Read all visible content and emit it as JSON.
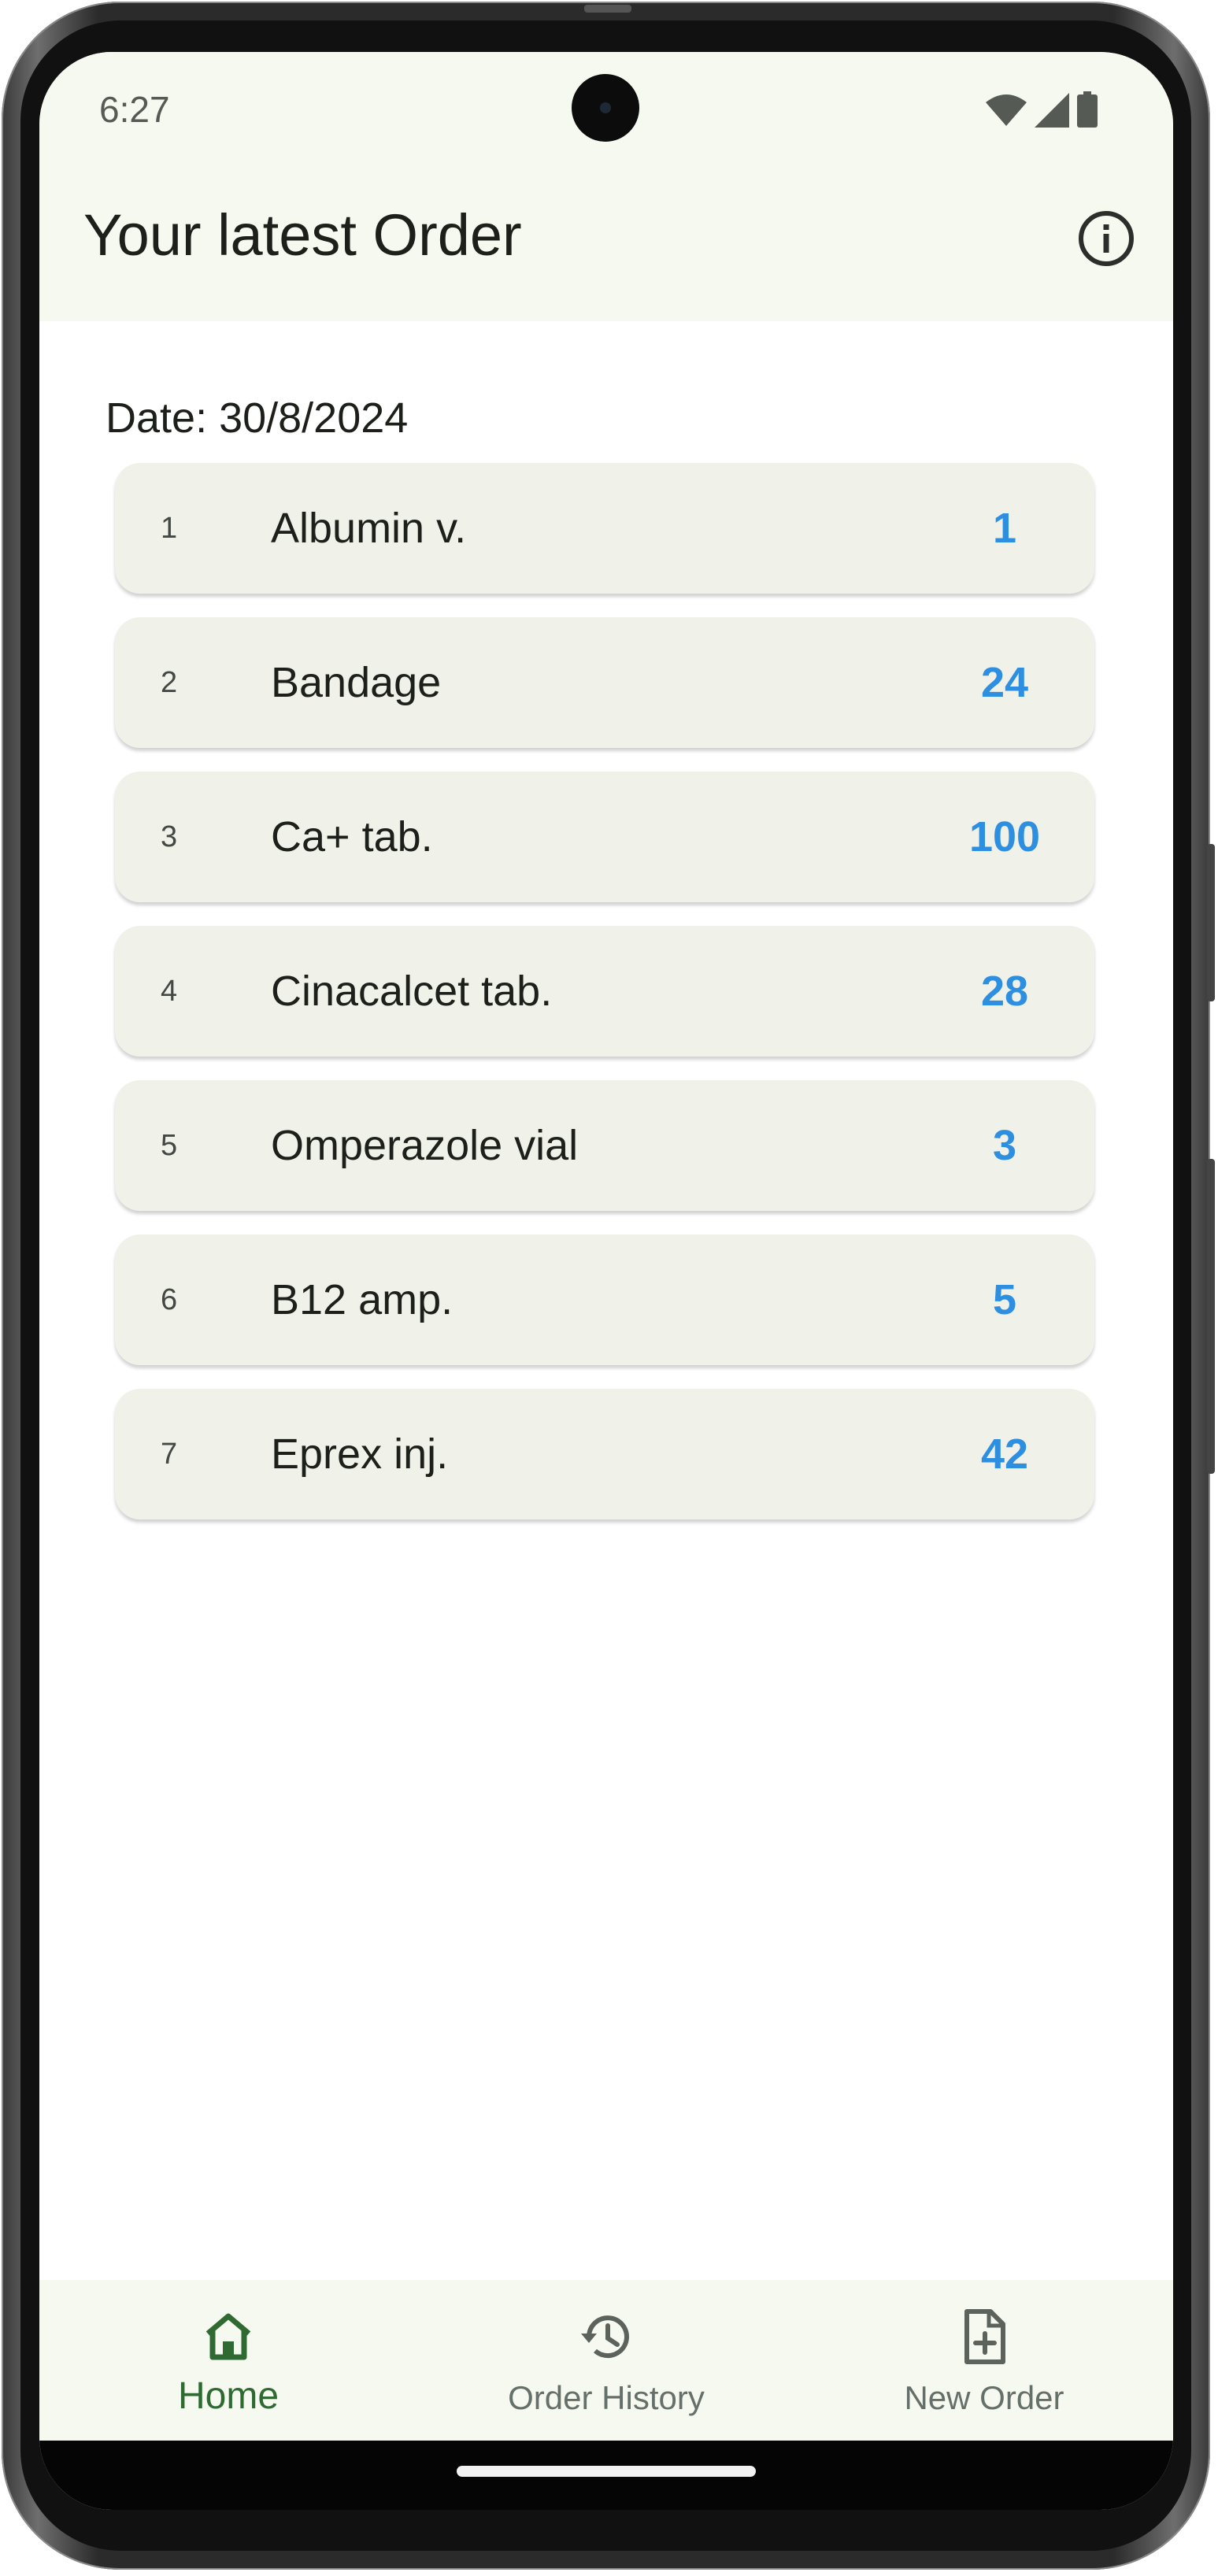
{
  "status_bar": {
    "time": "6:27",
    "icons": [
      "wifi-icon",
      "signal-icon",
      "battery-icon"
    ]
  },
  "app_bar": {
    "title": "Your latest Order",
    "action_icon": "info-icon"
  },
  "order": {
    "date_label": "Date: 30/8/2024",
    "items": [
      {
        "index": "1",
        "name": "Albumin v.",
        "qty": "1"
      },
      {
        "index": "2",
        "name": "Bandage",
        "qty": "24"
      },
      {
        "index": "3",
        "name": "Ca+ tab.",
        "qty": "100"
      },
      {
        "index": "4",
        "name": "Cinacalcet tab.",
        "qty": "28"
      },
      {
        "index": "5",
        "name": "Omperazole vial",
        "qty": "3"
      },
      {
        "index": "6",
        "name": "B12 amp.",
        "qty": "5"
      },
      {
        "index": "7",
        "name": "Eprex inj.",
        "qty": "42"
      }
    ]
  },
  "bottom_nav": {
    "items": [
      {
        "label": "Home",
        "icon": "home-icon",
        "active": true
      },
      {
        "label": "Order History",
        "icon": "history-icon",
        "active": false
      },
      {
        "label": "New Order",
        "icon": "new-document-icon",
        "active": false
      }
    ]
  },
  "colors": {
    "accent_green": "#2f6a33",
    "quantity_blue": "#2e8fe0",
    "surface": "#f6f9f0",
    "card": "#f0f2ea"
  }
}
